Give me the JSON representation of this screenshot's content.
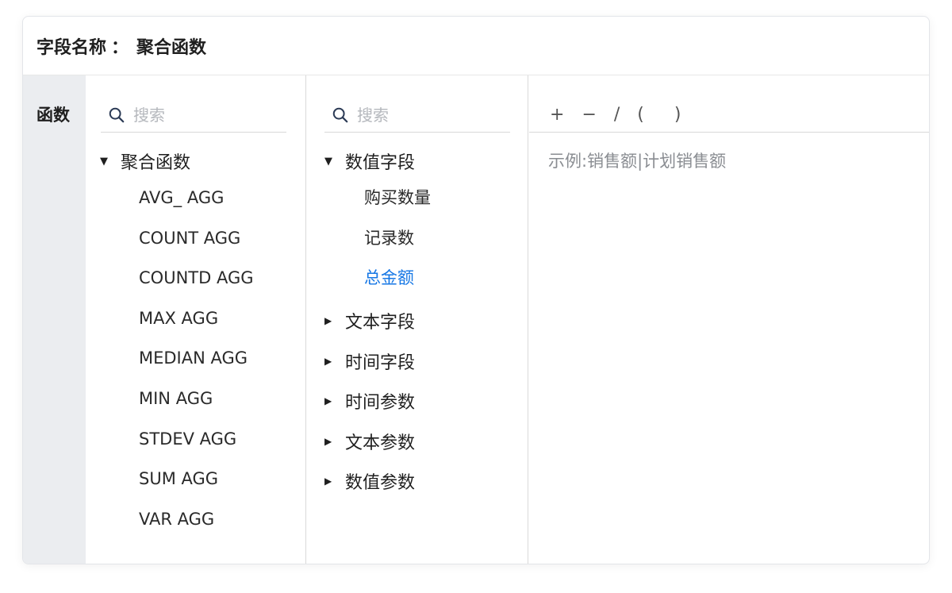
{
  "header": {
    "label": "字段名称",
    "separator": "：",
    "value": "聚合函数"
  },
  "side": {
    "label": "函数"
  },
  "functions": {
    "search_placeholder": "搜索",
    "group": "聚合函数",
    "items": [
      "AVG_ AGG",
      "COUNT AGG",
      "COUNTD AGG",
      "MAX AGG",
      "MEDIAN AGG",
      "MIN AGG",
      "STDEV AGG",
      "SUM AGG",
      "VAR AGG"
    ]
  },
  "fields": {
    "search_placeholder": "搜索",
    "expanded_group": "数值字段",
    "expanded_items": [
      "购买数量",
      "记录数",
      "总金额"
    ],
    "collapsed_groups": [
      "文本字段",
      "时间字段",
      "时间参数",
      "文本参数",
      "数值参数"
    ]
  },
  "editor": {
    "operators": [
      "+",
      "−",
      "/",
      "(",
      ")"
    ],
    "placeholder": "示例:销售额|计划销售额"
  },
  "colors": {
    "active": "#1677e5",
    "sidebar": "#ebedf0"
  }
}
